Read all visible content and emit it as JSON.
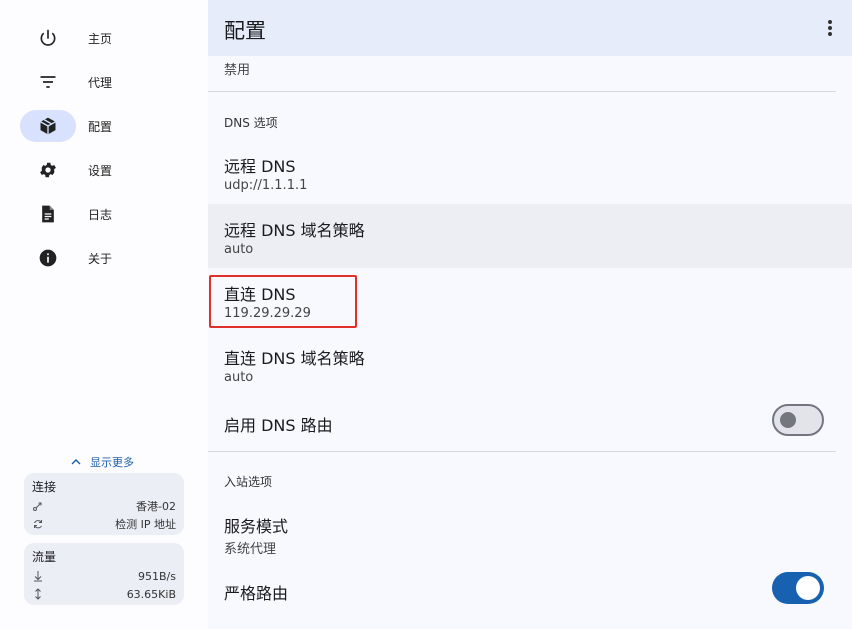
{
  "nav": {
    "items": [
      {
        "label": "主页",
        "icon": "power-icon"
      },
      {
        "label": "代理",
        "icon": "filter-list-icon"
      },
      {
        "label": "配置",
        "icon": "package-icon"
      },
      {
        "label": "设置",
        "icon": "gear-icon"
      },
      {
        "label": "日志",
        "icon": "document-icon"
      },
      {
        "label": "关于",
        "icon": "info-icon"
      }
    ],
    "active": "配置",
    "show_more": "显示更多"
  },
  "connection_card": {
    "title": "连接",
    "server": "香港-02",
    "test_ip": "检测 IP 地址"
  },
  "traffic_card": {
    "title": "流量",
    "speed": "951B/s",
    "total": "63.65KiB"
  },
  "header": {
    "title": "配置"
  },
  "settings": {
    "top_value": "禁用",
    "dns_section": "DNS 选项",
    "remote_dns": {
      "title": "远程 DNS",
      "value": "udp://1.1.1.1"
    },
    "remote_dns_strategy": {
      "title": "远程 DNS 域名策略",
      "value": "auto"
    },
    "direct_dns": {
      "title": "直连 DNS",
      "value": "119.29.29.29"
    },
    "direct_dns_strategy": {
      "title": "直连 DNS 域名策略",
      "value": "auto"
    },
    "dns_routing": {
      "title": "启用 DNS 路由",
      "enabled": false
    },
    "inbound_section": "入站选项",
    "service_mode": {
      "title": "服务模式",
      "value": "系统代理"
    },
    "strict_route": {
      "title": "严格路由",
      "enabled": true
    }
  },
  "colors": {
    "accent": "#1761b0",
    "active_pill": "#d8e2ff",
    "highlight_box": "#e0302a"
  }
}
